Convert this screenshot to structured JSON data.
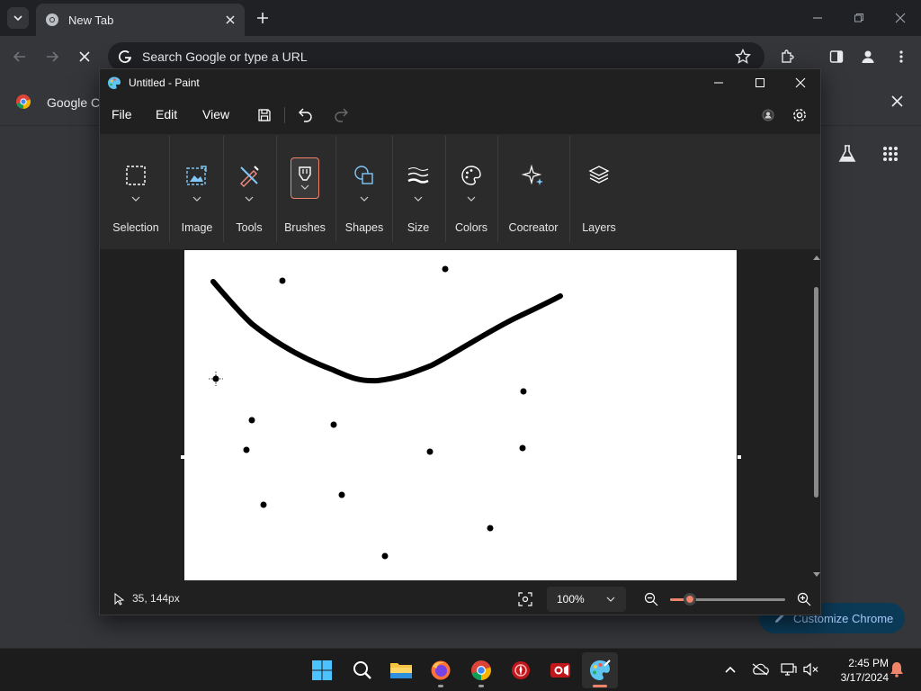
{
  "browser": {
    "tab_title": "New Tab",
    "omnibox_placeholder": "Search Google or type a URL",
    "bookmark_text": "Google Ch",
    "customize_label": "Customize Chrome"
  },
  "paint": {
    "window_title": "Untitled - Paint",
    "menu": {
      "file": "File",
      "edit": "Edit",
      "view": "View"
    },
    "ribbon": {
      "selection": "Selection",
      "image": "Image",
      "tools": "Tools",
      "brushes": "Brushes",
      "shapes": "Shapes",
      "size": "Size",
      "colors": "Colors",
      "cocreator": "Cocreator",
      "layers": "Layers"
    },
    "status": {
      "cursor_position": "35, 144px",
      "zoom": "100%",
      "zoom_slider_fraction": 0.17
    },
    "colors": {
      "accent": "#f0846b",
      "ink": "#000000",
      "canvas": "#ffffff"
    }
  },
  "taskbar": {
    "time": "2:45 PM",
    "date": "3/17/2024",
    "apps": [
      "start-icon",
      "search-icon",
      "file-explorer-icon",
      "firefox-icon",
      "chrome-icon",
      "app-red-icon",
      "recorder-icon",
      "paint-icon"
    ]
  }
}
